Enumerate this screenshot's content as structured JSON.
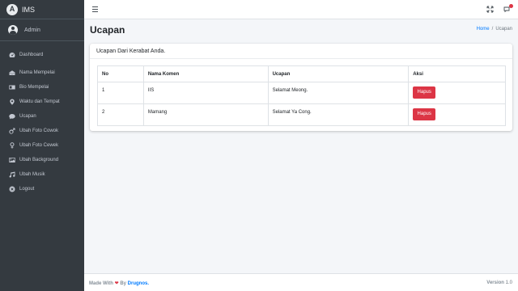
{
  "brand": {
    "logo_letter": "A",
    "name": "IMS"
  },
  "user": {
    "name": "Admin"
  },
  "sidebar": {
    "items": [
      {
        "label": "Dashboard",
        "icon": "tachometer-icon"
      },
      {
        "label": "Nama Mempelai",
        "icon": "envelope-open-icon"
      },
      {
        "label": "Bio Mempelai",
        "icon": "id-card-icon"
      },
      {
        "label": "Waktu dan Tempat",
        "icon": "map-marker-icon"
      },
      {
        "label": "Ucapan",
        "icon": "comment-icon"
      },
      {
        "label": "Ubah Foto Cowok",
        "icon": "mars-icon"
      },
      {
        "label": "Ubah Foto Cewek",
        "icon": "venus-icon"
      },
      {
        "label": "Ubah Background",
        "icon": "image-icon"
      },
      {
        "label": "Ubah Musik",
        "icon": "music-icon"
      },
      {
        "label": "Logout",
        "icon": "times-circle-icon"
      }
    ]
  },
  "header": {
    "title": "Ucapan"
  },
  "breadcrumb": {
    "home": "Home",
    "separator": "/",
    "current": "Ucapan"
  },
  "card": {
    "title": "Ucapan Dari Kerabat Anda."
  },
  "table": {
    "headers": {
      "no": "No",
      "nama": "Nama Komen",
      "ucapan": "Ucapan",
      "aksi": "Aksi"
    },
    "rows": [
      {
        "no": "1",
        "nama": "IIS",
        "ucapan": "Selamat Meong.",
        "action": "Hapus"
      },
      {
        "no": "2",
        "nama": "Mamang",
        "ucapan": "Selamat Ya Cong.",
        "action": "Hapus"
      }
    ]
  },
  "footer": {
    "made_with": "Made With",
    "by": "By",
    "author": "Drugnos.",
    "version_label": "Version",
    "version": "1.0"
  },
  "colors": {
    "sidebar": "#343a40",
    "accent": "#007bff",
    "danger": "#dc3545",
    "background": "#f4f6f9"
  }
}
